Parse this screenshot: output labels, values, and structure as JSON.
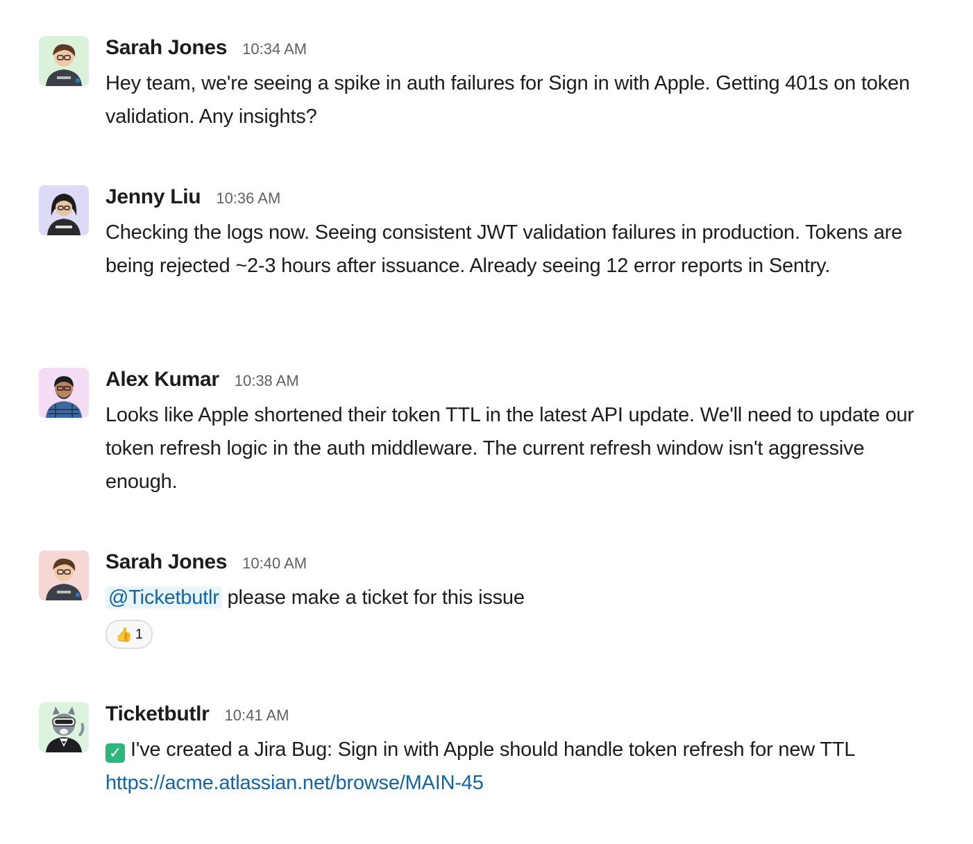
{
  "messages": [
    {
      "author": "Sarah Jones",
      "time": "10:34 AM",
      "avatar_icon": "sarah-avatar-icon",
      "text": "Hey team, we're seeing a spike in auth failures for Sign in with Apple. Getting 401s on token validation. Any insights?"
    },
    {
      "author": "Jenny Liu",
      "time": "10:36 AM",
      "avatar_icon": "jenny-avatar-icon",
      "text": "Checking the logs now. Seeing consistent JWT validation failures in production. Tokens are being rejected ~2-3 hours after issuance. Already seeing 12 error reports in Sentry."
    },
    {
      "author": "Alex Kumar",
      "time": "10:38 AM",
      "avatar_icon": "alex-avatar-icon",
      "text": "Looks like Apple shortened their token TTL in the latest API update. We'll need to update our token refresh logic in the auth middleware. The current refresh window isn't aggressive enough."
    },
    {
      "author": "Sarah Jones",
      "time": "10:40 AM",
      "avatar_icon": "sarah-avatar-icon",
      "mention": "@Ticketbutlr",
      "text": "please make a ticket for this issue",
      "reaction": {
        "emoji": "👍",
        "count": "1"
      }
    },
    {
      "author": "Ticketbutlr",
      "time": "10:41 AM",
      "avatar_icon": "bot-cat-avatar-icon",
      "check_icon": "✓",
      "text": "I've created a Jira Bug: Sign in with Apple should handle token refresh for new TTL",
      "link": "https://acme.atlassian.net/browse/MAIN-45"
    }
  ],
  "colors": {
    "link": "#1264a3",
    "mention_bg": "#e8f5fa",
    "check_green": "#2eb67d",
    "timestamp": "#616061"
  }
}
